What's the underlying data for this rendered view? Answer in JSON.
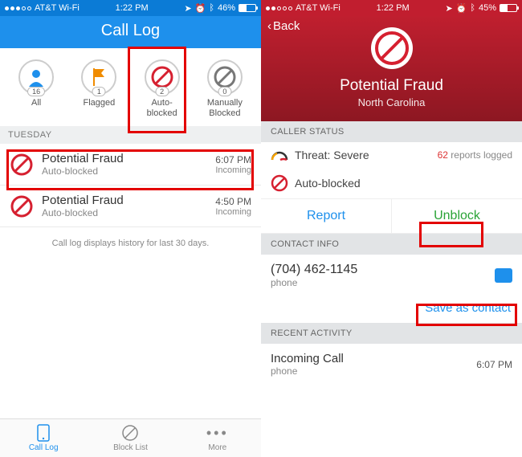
{
  "left": {
    "status": {
      "carrier": "AT&T Wi-Fi",
      "time": "1:22 PM",
      "battery": "46%"
    },
    "title": "Call Log",
    "filters": [
      {
        "label": "All",
        "count": "16"
      },
      {
        "label": "Flagged",
        "count": "1"
      },
      {
        "label": "Auto-\nblocked",
        "count": "2"
      },
      {
        "label": "Manually\nBlocked",
        "count": "0"
      }
    ],
    "day": "TUESDAY",
    "rows": [
      {
        "title": "Potential Fraud",
        "sub": "Auto-blocked",
        "time": "6:07 PM",
        "type": "Incoming"
      },
      {
        "title": "Potential Fraud",
        "sub": "Auto-blocked",
        "time": "4:50 PM",
        "type": "Incoming"
      }
    ],
    "note": "Call log displays history for last 30 days.",
    "tabs": [
      {
        "l": "Call Log"
      },
      {
        "l": "Block List"
      },
      {
        "l": "More"
      }
    ]
  },
  "right": {
    "status": {
      "carrier": "AT&T Wi-Fi",
      "time": "1:22 PM",
      "battery": "45%"
    },
    "back": "Back",
    "name": "Potential Fraud",
    "loc": "North Carolina",
    "h1": "CALLER STATUS",
    "threat": "Threat: Severe",
    "reports_n": "62",
    "reports_t": " reports logged",
    "blocked": "Auto-blocked",
    "report": "Report",
    "unblock": "Unblock",
    "h2": "CONTACT INFO",
    "phone": "(704) 462-1145",
    "phone_l": "phone",
    "save": "Save as contact",
    "h3": "RECENT ACTIVITY",
    "act": "Incoming Call",
    "act_l": "phone",
    "act_t": "6:07 PM"
  }
}
